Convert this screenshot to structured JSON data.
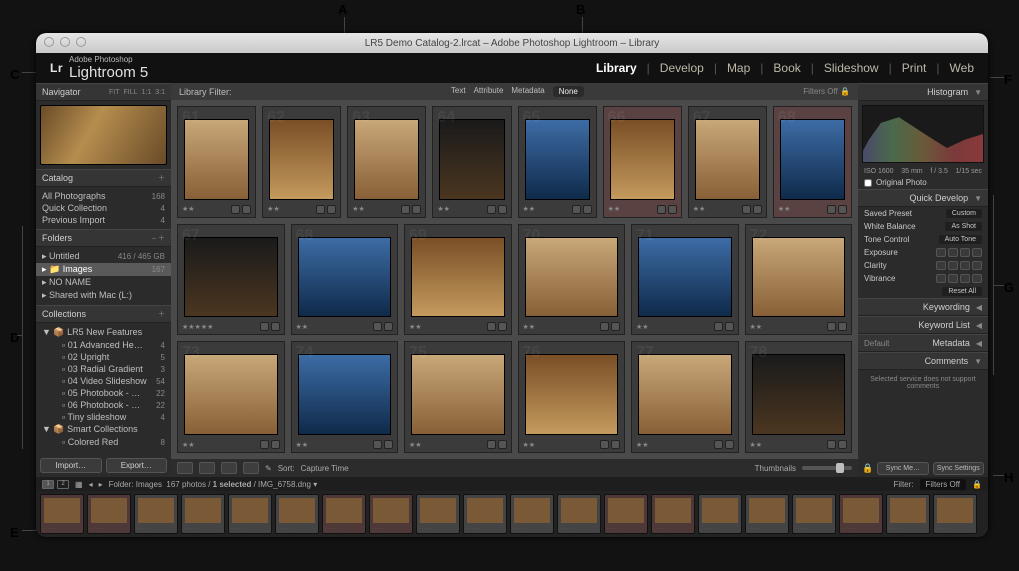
{
  "callouts": {
    "a": "A",
    "b": "B",
    "c": "C",
    "d": "D",
    "e": "E",
    "f": "F",
    "g": "G",
    "h": "H"
  },
  "window": {
    "title": "LR5 Demo Catalog-2.lrcat – Adobe Photoshop Lightroom – Library"
  },
  "identity": {
    "badge": "Lr",
    "sup1": "Adobe Photoshop",
    "name": "Lightroom 5"
  },
  "modules": [
    "Library",
    "Develop",
    "Map",
    "Book",
    "Slideshow",
    "Print",
    "Web"
  ],
  "active_module": "Library",
  "left": {
    "navigator": {
      "title": "Navigator",
      "tools": [
        "FIT",
        "FILL",
        "1:1",
        "3:1"
      ]
    },
    "catalog": {
      "title": "Catalog",
      "items": [
        {
          "label": "All Photographs",
          "count": "168"
        },
        {
          "label": "Quick Collection",
          "count": "4"
        },
        {
          "label": "Previous Import",
          "count": "4"
        }
      ]
    },
    "folders": {
      "title": "Folders",
      "drive": {
        "label": "Untitled",
        "info": "416 / 465 GB"
      },
      "children": [
        {
          "label": "Images",
          "count": "167",
          "selected": true
        }
      ],
      "other": [
        {
          "label": "NO NAME",
          "count": ""
        },
        {
          "label": "Shared with Mac (L:)",
          "count": ""
        }
      ]
    },
    "collections": {
      "title": "Collections",
      "sets": [
        {
          "label": "LR5 New Features",
          "children": [
            {
              "label": "01 Advanced He…",
              "count": "4"
            },
            {
              "label": "02 Upright",
              "count": "5"
            },
            {
              "label": "03 Radial Gradient",
              "count": "3"
            },
            {
              "label": "04 Video Slideshow",
              "count": "54"
            },
            {
              "label": "05 Photobook - …",
              "count": "22"
            },
            {
              "label": "06 Photobook - …",
              "count": "22"
            },
            {
              "label": "Tiny slideshow",
              "count": "4"
            }
          ]
        },
        {
          "label": "Smart Collections",
          "children": [
            {
              "label": "Colored Red",
              "count": "8"
            }
          ]
        }
      ]
    },
    "buttons": {
      "import": "Import…",
      "export": "Export…"
    }
  },
  "filter_bar": {
    "title": "Library Filter:",
    "tabs": [
      "Text",
      "Attribute",
      "Metadata",
      "None"
    ],
    "active_tab": "None",
    "status": "Filters Off"
  },
  "grid": {
    "rows": [
      {
        "start": 61,
        "flags": [
          0,
          0,
          0,
          0,
          0,
          1,
          0,
          1
        ]
      },
      {
        "start": 67,
        "flags": [
          0,
          0,
          0,
          0,
          0,
          0
        ]
      },
      {
        "start": 73,
        "flags": [
          0,
          0,
          0,
          0,
          0,
          0
        ]
      }
    ],
    "stars": "★★★★★"
  },
  "toolbar": {
    "sort_label": "Sort:",
    "sort_value": "Capture Time",
    "thumb_label": "Thumbnails"
  },
  "right": {
    "histogram": {
      "title": "Histogram",
      "info": [
        "ISO 1600",
        "35 mm",
        "f / 3.5",
        "1/15 sec"
      ],
      "checkbox": "Original Photo"
    },
    "quick_develop": {
      "title": "Quick Develop",
      "preset": {
        "label": "Saved Preset",
        "value": "Custom"
      },
      "wb": {
        "label": "White Balance",
        "value": "As Shot"
      },
      "tone": {
        "label": "Tone Control",
        "button": "Auto Tone"
      },
      "sliders": [
        "Exposure",
        "Clarity",
        "Vibrance"
      ],
      "reset": "Reset All"
    },
    "panels": [
      "Keywording",
      "Keyword List",
      "Metadata",
      "Comments"
    ],
    "metadata_preset": "Default",
    "comments_msg": "Selected service does not support comments",
    "sync": {
      "left": "Sync Me…",
      "right": "Sync Settings"
    },
    "lock_icon": "lock-icon"
  },
  "filmstrip_bar": {
    "monitors": [
      "1",
      "2"
    ],
    "folder_label": "Folder: Images",
    "count": "167 photos",
    "selected": "1 selected",
    "file": "IMG_6758.dng",
    "filter_label": "Filter:",
    "filter_value": "Filters Off"
  },
  "filmstrip": {
    "count": 20,
    "red_indices": [
      0,
      1,
      6,
      7,
      12,
      13,
      17
    ]
  }
}
